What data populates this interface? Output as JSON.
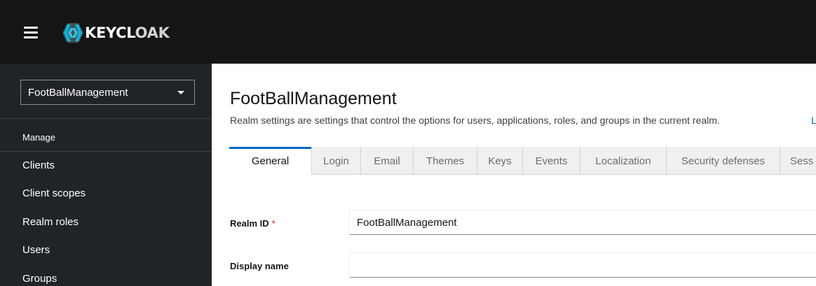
{
  "masthead": {
    "logo_text_a": "KEYCL",
    "logo_text_b": "OAK"
  },
  "sidebar": {
    "realm_selector": "FootBallManagement",
    "section_title": "Manage",
    "items": [
      {
        "label": "Clients"
      },
      {
        "label": "Client scopes"
      },
      {
        "label": "Realm roles"
      },
      {
        "label": "Users"
      },
      {
        "label": "Groups"
      }
    ]
  },
  "main": {
    "title": "FootBallManagement",
    "description": "Realm settings are settings that control the options for users, applications, roles, and groups in the current realm.",
    "learn_more": "L",
    "tabs": [
      {
        "label": "General",
        "active": true
      },
      {
        "label": "Login"
      },
      {
        "label": "Email"
      },
      {
        "label": "Themes"
      },
      {
        "label": "Keys"
      },
      {
        "label": "Events"
      },
      {
        "label": "Localization"
      },
      {
        "label": "Security defenses"
      },
      {
        "label": "Sess"
      }
    ],
    "fields": {
      "realm_id": {
        "label": "Realm ID",
        "required_mark": "*",
        "value": "FootBallManagement"
      },
      "display_name": {
        "label": "Display name",
        "value": ""
      }
    }
  },
  "colors": {
    "masthead_bg": "#151515",
    "sidebar_bg": "#212427",
    "accent": "#0066cc",
    "required": "#c9190b"
  }
}
